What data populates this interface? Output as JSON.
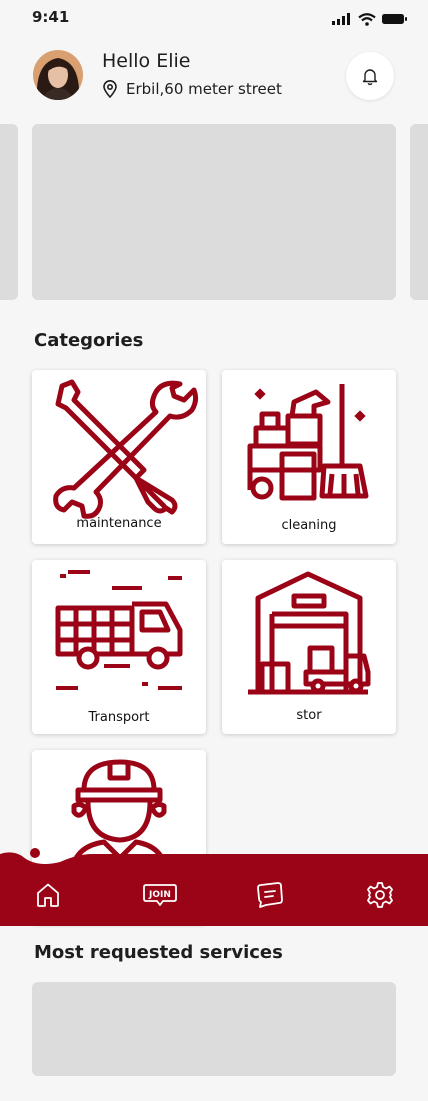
{
  "status_bar": {
    "time": "9:41"
  },
  "header": {
    "greeting": "Hello Elie",
    "location": "Erbil,60 meter street"
  },
  "categories": {
    "title": "Categories",
    "items": [
      {
        "label": "maintenance",
        "icon": "tools-icon"
      },
      {
        "label": "cleaning",
        "icon": "cleaning-icon"
      },
      {
        "label": "Transport",
        "icon": "truck-icon"
      },
      {
        "label": "stor",
        "icon": "warehouse-icon"
      },
      {
        "label": "",
        "icon": "worker-icon"
      }
    ]
  },
  "bottom_nav": {
    "items": [
      {
        "icon": "home-icon",
        "label": ""
      },
      {
        "icon": "join-icon",
        "label": "JOIN"
      },
      {
        "icon": "chat-icon",
        "label": ""
      },
      {
        "icon": "settings-icon",
        "label": ""
      }
    ]
  },
  "most_requested": {
    "title": "Most requested services"
  },
  "colors": {
    "brand": "#9a0416",
    "background": "#f6f6f6",
    "placeholder": "#dcdcdc"
  }
}
